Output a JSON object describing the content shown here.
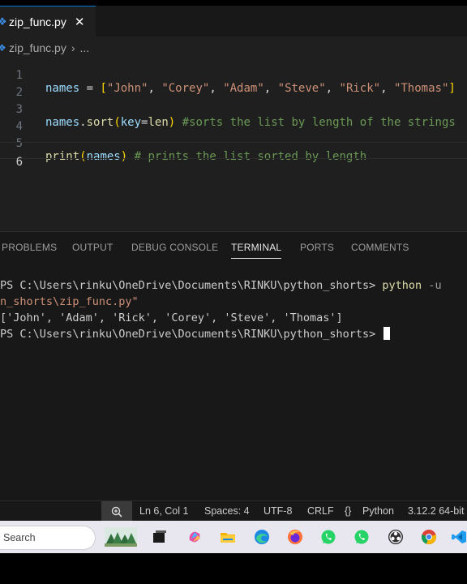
{
  "tab": {
    "filename": "zip_func.py",
    "close_glyph": "✕",
    "lang_glyph": "❖"
  },
  "breadcrumb": {
    "file": "zip_func.py",
    "separator": "›",
    "more": "..."
  },
  "editor": {
    "line_numbers": [
      "1",
      "2",
      "3",
      "4",
      "5",
      "6"
    ],
    "active_line": "6",
    "line1": {
      "var": "names",
      "eq": " = ",
      "open": "[",
      "s1": "\"John\"",
      "s2": "\"Corey\"",
      "s3": "\"Adam\"",
      "s4": "\"Steve\"",
      "s5": "\"Rick\"",
      "s6": "\"Thomas\"",
      "comma": ", ",
      "close": "]"
    },
    "line3": {
      "obj": "names",
      "dot": ".",
      "method": "sort",
      "open": "(",
      "param": "key",
      "eq": "=",
      "fn": "len",
      "close": ")",
      "comment": " #sorts the list by length of the strings"
    },
    "line5": {
      "fn": "print",
      "open": "(",
      "arg": "names",
      "close": ")",
      "comment": " # prints the list sorted by length"
    }
  },
  "panel": {
    "tabs": [
      "PROBLEMS",
      "OUTPUT",
      "DEBUG CONSOLE",
      "TERMINAL",
      "PORTS",
      "COMMENTS"
    ],
    "active_tab": "TERMINAL"
  },
  "terminal": {
    "prompt1": "PS C:\\Users\\rinku\\OneDrive\\Documents\\RINKU\\python_shorts> ",
    "cmd": "python",
    "flag": " -u ",
    "path_cont": "n_shorts\\zip_func.py\"",
    "output": "['John', 'Adam', 'Rick', 'Corey', 'Steve', 'Thomas']",
    "prompt2": "PS C:\\Users\\rinku\\OneDrive\\Documents\\RINKU\\python_shorts> "
  },
  "status_bar": {
    "position": "Ln 6, Col 1",
    "spaces": "Spaces: 4",
    "encoding": "UTF-8",
    "eol": "CRLF",
    "lang_glyph": "{}",
    "language": "Python",
    "interpreter": "3.12.2 64-bit"
  },
  "taskbar": {
    "search_label": "Search",
    "icons": [
      "landscape-widget-icon",
      "task-view-icon",
      "copilot-icon",
      "file-explorer-icon",
      "edge-icon",
      "firefox-icon",
      "whatsapp-icon",
      "whatsapp-icon-2",
      "obs-icon",
      "chrome-icon",
      "vscode-icon"
    ]
  },
  "colors": {
    "accent": "#0078d4",
    "editor_bg": "#1f1f1f",
    "panel_bg": "#181818",
    "string": "#ce9178",
    "comment": "#6a9955",
    "function": "#dcdcaa",
    "variable": "#9cdcfe"
  }
}
